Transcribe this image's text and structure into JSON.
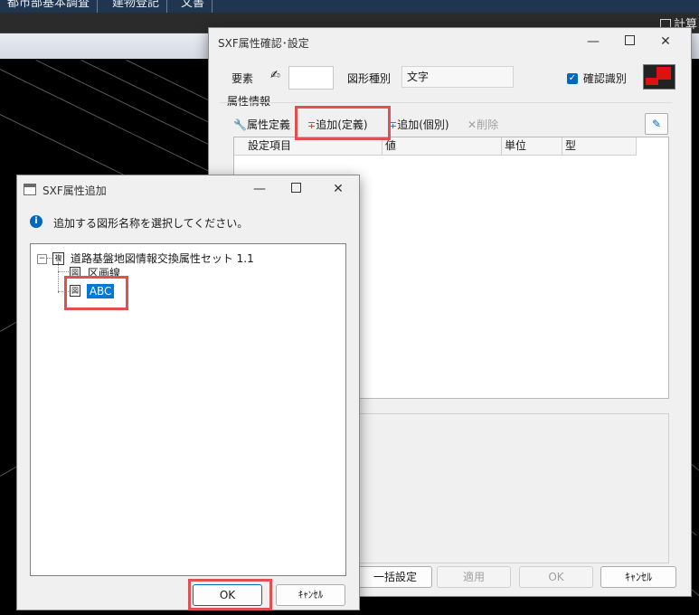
{
  "app": {
    "tabs": [
      "都市部基本調査",
      "建物登記",
      "文書"
    ],
    "right_label": "計算"
  },
  "sxf_window": {
    "title": "SXF属性確認･設定",
    "element_label": "要素",
    "element_value": "",
    "shape_type_label": "図形種別",
    "shape_type_value": "文字",
    "confirm_checkbox_label": "確認識別",
    "confirm_checked": true,
    "attribute_group_label": "属性情報",
    "toolbar": {
      "attr_def": "属性定義",
      "add_def": "追加(定義)",
      "add_individual": "追加(個別)",
      "delete": "削除"
    },
    "columns": [
      "設定項目",
      "値",
      "単位",
      "型"
    ],
    "buttons": {
      "batch_set": "一括設定",
      "apply": "適用",
      "ok": "OK",
      "cancel": "ｷｬﾝｾﾙ"
    }
  },
  "add_dialog": {
    "title": "SXF属性追加",
    "instruction": "追加する図形名称を選択してください。",
    "tree": {
      "root_label": "道路基盤地図情報交換属性セット 1.1",
      "children": [
        "区画線",
        "ABC"
      ],
      "selected_index": 1
    },
    "buttons": {
      "ok": "OK",
      "cancel": "ｷｬﾝｾﾙ"
    }
  },
  "colors": {
    "highlight": "#e05050",
    "selection": "#0078d7",
    "checkbox": "#0067c0"
  }
}
